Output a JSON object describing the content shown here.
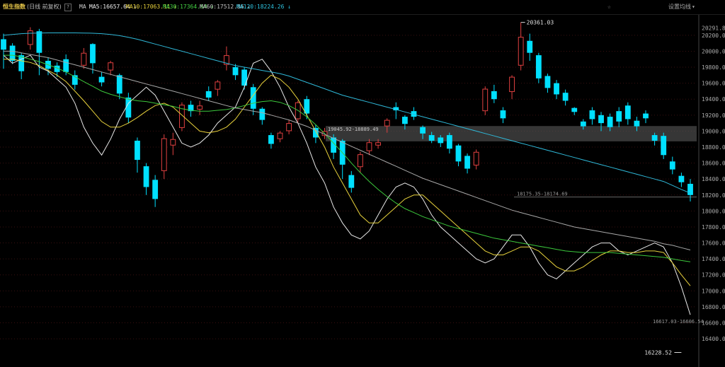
{
  "header": {
    "title": "恒生指数",
    "subtitle": "(日线 前复权)",
    "help": "?",
    "ma_label": "MA",
    "ma5": "MA5:16657.64 ↓",
    "ma10": "MA10:17063.11 ↓",
    "ma30": "MA30:17364.64 ↓",
    "ma60": "MA60:17512.86 ↓",
    "ma120": "MA120:18224.26 ↓",
    "star": "☆",
    "settings": "设置均线",
    "dropdown": "▾"
  },
  "colors": {
    "up": "#e04040",
    "down": "#00e0ff",
    "ma5": "#e8e8e8",
    "ma10": "#e8d23c",
    "ma30": "#3cc83c",
    "ma60": "#a8a8a8",
    "ma120": "#2fb8d8",
    "grid": "#3a1010",
    "axis_text": "#aaaaaa"
  },
  "chart_data": {
    "type": "candlestick",
    "ylim": [
      16100,
      20420
    ],
    "y_ticks": [
      "20291.8",
      "20200.0",
      "20000.0",
      "19800.0",
      "19600.0",
      "19400.0",
      "19200.0",
      "19000.0",
      "18800.0",
      "18600.0",
      "18400.0",
      "18200.0",
      "18000.0",
      "17800.0",
      "17600.0",
      "17400.0",
      "17200.0",
      "17000.0",
      "16800.0",
      "16600.0",
      "16400.0"
    ],
    "y_tick_values": [
      20291.8,
      20200,
      20000,
      19800,
      19600,
      19400,
      19200,
      19000,
      18800,
      18600,
      18400,
      18200,
      18000,
      17800,
      17600,
      17400,
      17200,
      17000,
      16800,
      16600,
      16400
    ],
    "annotations": {
      "high_label": "20361.03",
      "high_value": 20361.03,
      "low_label": "16228.52",
      "low_value": 16228.52,
      "zone1_label": "19045.92-18889.49",
      "zone1": [
        19045.92,
        18889.49
      ],
      "zone2_label": "18175.35-18174.69",
      "zone2_value": 18175,
      "zone3_label": "16617.03-16606.54",
      "zone3_value": 16612
    },
    "moving_averages": [
      {
        "name": "MA5",
        "values": [
          19950,
          19850,
          19900,
          19950,
          19800,
          19750,
          19650,
          19550,
          19350,
          19050,
          18850,
          18700,
          18900,
          19150,
          19350,
          19450,
          19550,
          19450,
          19250,
          19050,
          18850,
          18800,
          18850,
          18950,
          19100,
          19200,
          19300,
          19550,
          19850,
          19900,
          19750,
          19550,
          19300,
          19100,
          18850,
          18550,
          18350,
          18050,
          17850,
          17700,
          17650,
          17750,
          17950,
          18150,
          18300,
          18350,
          18300,
          18150,
          17950,
          17800,
          17700,
          17600,
          17500,
          17400,
          17350,
          17400,
          17550,
          17700,
          17700,
          17550,
          17350,
          17200,
          17150,
          17250,
          17350,
          17450,
          17550,
          17600,
          17600,
          17500,
          17450,
          17500,
          17550,
          17600,
          17550,
          17350,
          17050,
          16700
        ]
      },
      {
        "name": "MA10",
        "values": [
          19900,
          19900,
          19880,
          19860,
          19820,
          19760,
          19700,
          19620,
          19500,
          19380,
          19250,
          19120,
          19050,
          19050,
          19100,
          19170,
          19250,
          19320,
          19350,
          19300,
          19200,
          19100,
          19000,
          18980,
          19000,
          19050,
          19150,
          19300,
          19450,
          19600,
          19700,
          19650,
          19550,
          19400,
          19200,
          19000,
          18800,
          18550,
          18350,
          18150,
          17950,
          17850,
          17850,
          17950,
          18050,
          18150,
          18200,
          18200,
          18100,
          18000,
          17900,
          17800,
          17700,
          17600,
          17500,
          17450,
          17450,
          17500,
          17550,
          17550,
          17500,
          17400,
          17300,
          17250,
          17250,
          17300,
          17380,
          17450,
          17500,
          17500,
          17480,
          17480,
          17500,
          17500,
          17480,
          17350,
          17200,
          17063
        ]
      },
      {
        "name": "MA30",
        "values": [
          19950,
          19950,
          19930,
          19900,
          19870,
          19830,
          19790,
          19740,
          19680,
          19620,
          19560,
          19500,
          19460,
          19430,
          19400,
          19380,
          19370,
          19350,
          19330,
          19310,
          19280,
          19260,
          19250,
          19250,
          19260,
          19270,
          19290,
          19320,
          19350,
          19370,
          19380,
          19360,
          19320,
          19260,
          19180,
          19080,
          18970,
          18850,
          18730,
          18600,
          18480,
          18370,
          18270,
          18180,
          18100,
          18030,
          17980,
          17930,
          17890,
          17850,
          17810,
          17780,
          17750,
          17720,
          17690,
          17660,
          17640,
          17620,
          17600,
          17580,
          17560,
          17540,
          17520,
          17500,
          17490,
          17480,
          17480,
          17480,
          17480,
          17470,
          17460,
          17450,
          17440,
          17430,
          17420,
          17400,
          17380,
          17364
        ]
      },
      {
        "name": "MA60",
        "values": [
          20000,
          20000,
          19980,
          19960,
          19940,
          19920,
          19890,
          19860,
          19830,
          19800,
          19770,
          19740,
          19710,
          19680,
          19650,
          19620,
          19590,
          19560,
          19530,
          19500,
          19470,
          19440,
          19410,
          19380,
          19350,
          19320,
          19290,
          19270,
          19250,
          19230,
          19200,
          19170,
          19140,
          19100,
          19060,
          19010,
          18960,
          18910,
          18860,
          18810,
          18760,
          18710,
          18660,
          18610,
          18560,
          18510,
          18460,
          18410,
          18370,
          18330,
          18290,
          18250,
          18210,
          18170,
          18130,
          18090,
          18050,
          18010,
          17980,
          17950,
          17920,
          17890,
          17860,
          17830,
          17800,
          17780,
          17760,
          17740,
          17720,
          17700,
          17680,
          17660,
          17640,
          17620,
          17590,
          17570,
          17540,
          17512
        ]
      },
      {
        "name": "MA120",
        "values": [
          20200,
          20210,
          20220,
          20225,
          20228,
          20230,
          20230,
          20230,
          20230,
          20228,
          20225,
          20220,
          20210,
          20195,
          20175,
          20150,
          20120,
          20090,
          20060,
          20030,
          20000,
          19970,
          19940,
          19910,
          19880,
          19850,
          19820,
          19800,
          19780,
          19760,
          19740,
          19720,
          19690,
          19650,
          19610,
          19570,
          19530,
          19490,
          19450,
          19420,
          19390,
          19360,
          19330,
          19300,
          19270,
          19240,
          19210,
          19180,
          19150,
          19120,
          19090,
          19060,
          19030,
          19000,
          18970,
          18940,
          18910,
          18880,
          18850,
          18820,
          18790,
          18760,
          18730,
          18700,
          18670,
          18640,
          18610,
          18580,
          18550,
          18520,
          18490,
          18460,
          18430,
          18400,
          18370,
          18320,
          18270,
          18224
        ]
      }
    ],
    "candles": [
      [
        20150,
        20020,
        20220,
        19780
      ],
      [
        20070,
        19880,
        20100,
        19840
      ],
      [
        19950,
        19750,
        19980,
        19650
      ],
      [
        20080,
        20260,
        20300,
        20020
      ],
      [
        20250,
        19980,
        20280,
        19700
      ],
      [
        19880,
        19780,
        19920,
        19700
      ],
      [
        19820,
        19740,
        19860,
        19680
      ],
      [
        19900,
        19740,
        19960,
        19700
      ],
      [
        19700,
        19580,
        19760,
        19520
      ],
      [
        19820,
        19980,
        20040,
        19780
      ],
      [
        20090,
        19850,
        20100,
        19720
      ],
      [
        19680,
        19610,
        19740,
        19560
      ],
      [
        19760,
        19860,
        19880,
        19700
      ],
      [
        19700,
        19470,
        19720,
        19400
      ],
      [
        19420,
        19170,
        19480,
        19100
      ],
      [
        18880,
        18640,
        18920,
        18480
      ],
      [
        18560,
        18300,
        18600,
        18200
      ],
      [
        18390,
        18150,
        18450,
        18050
      ],
      [
        18500,
        18910,
        18960,
        18400
      ],
      [
        18820,
        18900,
        18980,
        18700
      ],
      [
        19040,
        19330,
        19360,
        19000
      ],
      [
        19330,
        19250,
        19380,
        19180
      ],
      [
        19270,
        19320,
        19380,
        19200
      ],
      [
        19500,
        19420,
        19560,
        19380
      ],
      [
        19520,
        19620,
        19640,
        19440
      ],
      [
        19830,
        19950,
        20060,
        19760
      ],
      [
        19800,
        19700,
        19840,
        19640
      ],
      [
        19770,
        19570,
        19800,
        19520
      ],
      [
        19550,
        19280,
        19590,
        19200
      ],
      [
        19280,
        19140,
        19300,
        19080
      ],
      [
        18950,
        18840,
        18980,
        18780
      ],
      [
        18900,
        18980,
        19000,
        18860
      ],
      [
        19000,
        19100,
        19140,
        18960
      ],
      [
        19150,
        19360,
        19380,
        19100
      ],
      [
        19400,
        19220,
        19440,
        19150
      ],
      [
        19040,
        18920,
        19080,
        18850
      ],
      [
        18940,
        19000,
        19040,
        18900
      ],
      [
        18920,
        18730,
        18960,
        18650
      ],
      [
        18880,
        18580,
        18900,
        18400
      ],
      [
        18450,
        18290,
        18500,
        18230
      ],
      [
        18550,
        18710,
        18740,
        18480
      ],
      [
        18750,
        18860,
        18900,
        18700
      ],
      [
        18820,
        18860,
        18900,
        18780
      ],
      [
        19060,
        19140,
        19160,
        18980
      ],
      [
        19300,
        19260,
        19360,
        19150
      ],
      [
        19180,
        19090,
        19200,
        19020
      ],
      [
        19250,
        19180,
        19300,
        19140
      ],
      [
        19050,
        18970,
        19070,
        18900
      ],
      [
        18950,
        18880,
        18990,
        18850
      ],
      [
        18920,
        18850,
        18950,
        18800
      ],
      [
        18950,
        18780,
        18980,
        18720
      ],
      [
        18820,
        18620,
        18840,
        18560
      ],
      [
        18690,
        18530,
        18720,
        18470
      ],
      [
        18570,
        18740,
        18770,
        18520
      ],
      [
        19250,
        19530,
        19560,
        19200
      ],
      [
        19500,
        19400,
        19580,
        19350
      ],
      [
        19260,
        19160,
        19300,
        19100
      ],
      [
        19490,
        19680,
        19700,
        19400
      ],
      [
        19820,
        20180,
        20361,
        19760
      ],
      [
        20130,
        19980,
        20220,
        19880
      ],
      [
        19950,
        19660,
        19980,
        19600
      ],
      [
        19690,
        19540,
        19720,
        19480
      ],
      [
        19600,
        19460,
        19640,
        19400
      ],
      [
        19480,
        19380,
        19520,
        19320
      ],
      [
        19290,
        19240,
        19300,
        19200
      ],
      [
        19120,
        19060,
        19150,
        19020
      ],
      [
        19260,
        19150,
        19300,
        19080
      ],
      [
        19200,
        19100,
        19240,
        19000
      ],
      [
        19180,
        19050,
        19220,
        19000
      ],
      [
        19250,
        19120,
        19300,
        19050
      ],
      [
        19320,
        19150,
        19360,
        19080
      ],
      [
        19130,
        19060,
        19180,
        19000
      ],
      [
        19220,
        19160,
        19260,
        19100
      ],
      [
        18950,
        18880,
        18980,
        18820
      ],
      [
        18940,
        18700,
        18980,
        18650
      ],
      [
        18620,
        18520,
        18680,
        18460
      ],
      [
        18440,
        18360,
        18480,
        18300
      ],
      [
        18340,
        18200,
        18400,
        18120
      ]
    ]
  }
}
